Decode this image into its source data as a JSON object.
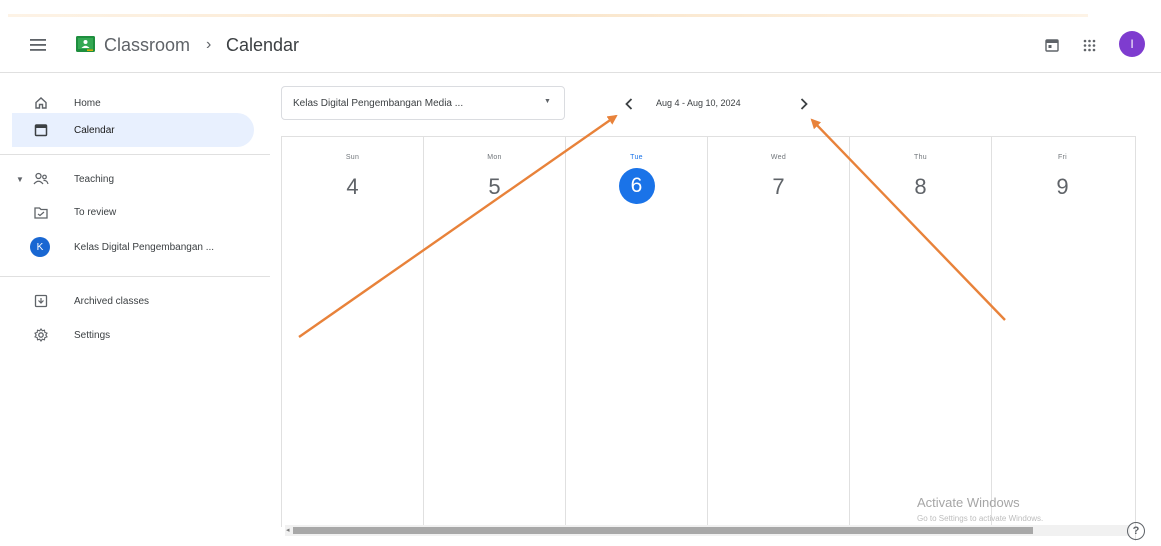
{
  "header": {
    "menu_icon": "hamburger-menu-icon",
    "logo_icon": "classroom-logo-icon",
    "app_title": "Classroom",
    "breadcrumb_separator": "›",
    "current_page": "Calendar",
    "calendar_icon": "calendar-icon",
    "apps_icon": "apps-grid-icon",
    "avatar_initial": "I",
    "avatar_color": "#7e3ccf"
  },
  "sidebar": {
    "home": {
      "label": "Home",
      "icon": "home-icon"
    },
    "calendar": {
      "label": "Calendar",
      "icon": "calendar-icon",
      "active": true
    },
    "teaching": {
      "label": "Teaching",
      "icon": "people-icon",
      "expanded": true
    },
    "to_review": {
      "label": "To review",
      "icon": "folder-review-icon"
    },
    "class_item": {
      "label": "Kelas Digital Pengembangan ...",
      "avatar_letter": "K",
      "avatar_color": "#1967d2"
    },
    "archived": {
      "label": "Archived classes",
      "icon": "archive-icon"
    },
    "settings": {
      "label": "Settings",
      "icon": "settings-gear-icon"
    }
  },
  "toolbar": {
    "class_select_value": "Kelas Digital Pengembangan Media ...",
    "select_caret": "▼",
    "prev_icon": "chevron-left-icon",
    "next_icon": "chevron-right-icon",
    "date_range": "Aug 4 - Aug 10, 2024"
  },
  "week": {
    "days": [
      {
        "name": "Sun",
        "num": "4",
        "today": false
      },
      {
        "name": "Mon",
        "num": "5",
        "today": false
      },
      {
        "name": "Tue",
        "num": "6",
        "today": true
      },
      {
        "name": "Wed",
        "num": "7",
        "today": false
      },
      {
        "name": "Thu",
        "num": "8",
        "today": false
      },
      {
        "name": "Fri",
        "num": "9",
        "today": false
      }
    ],
    "today_color": "#1a73e8"
  },
  "watermark": {
    "title": "Activate Windows",
    "subtitle": "Go to Settings to activate Windows."
  },
  "help": {
    "label": "?",
    "icon": "help-icon"
  },
  "annotation": {
    "arrow_color": "#e8823a"
  }
}
